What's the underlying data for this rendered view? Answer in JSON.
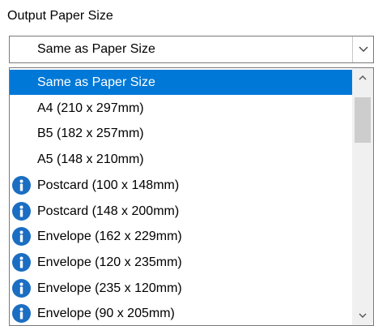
{
  "field": {
    "label": "Output Paper Size",
    "selected_value": "Same as Paper Size"
  },
  "icons": {
    "dropdown": "chevron-down-icon",
    "info": "info-icon",
    "scroll_up": "chevron-up-icon",
    "scroll_down": "chevron-down-icon"
  },
  "colors": {
    "selection_bg": "#0078d7",
    "selection_text": "#ffffff",
    "info_icon": "#1b6ec2"
  },
  "options": [
    {
      "label": "Same as Paper Size",
      "info": false,
      "selected": true
    },
    {
      "label": "A4 (210 x 297mm)",
      "info": false,
      "selected": false
    },
    {
      "label": "B5 (182 x 257mm)",
      "info": false,
      "selected": false
    },
    {
      "label": "A5 (148 x 210mm)",
      "info": false,
      "selected": false
    },
    {
      "label": "Postcard (100 x 148mm)",
      "info": true,
      "selected": false
    },
    {
      "label": "Postcard (148 x 200mm)",
      "info": true,
      "selected": false
    },
    {
      "label": "Envelope (162 x 229mm)",
      "info": true,
      "selected": false
    },
    {
      "label": "Envelope (120 x 235mm)",
      "info": true,
      "selected": false
    },
    {
      "label": "Envelope (235 x 120mm)",
      "info": true,
      "selected": false
    },
    {
      "label": "Envelope (90 x 205mm)",
      "info": true,
      "selected": false
    }
  ]
}
